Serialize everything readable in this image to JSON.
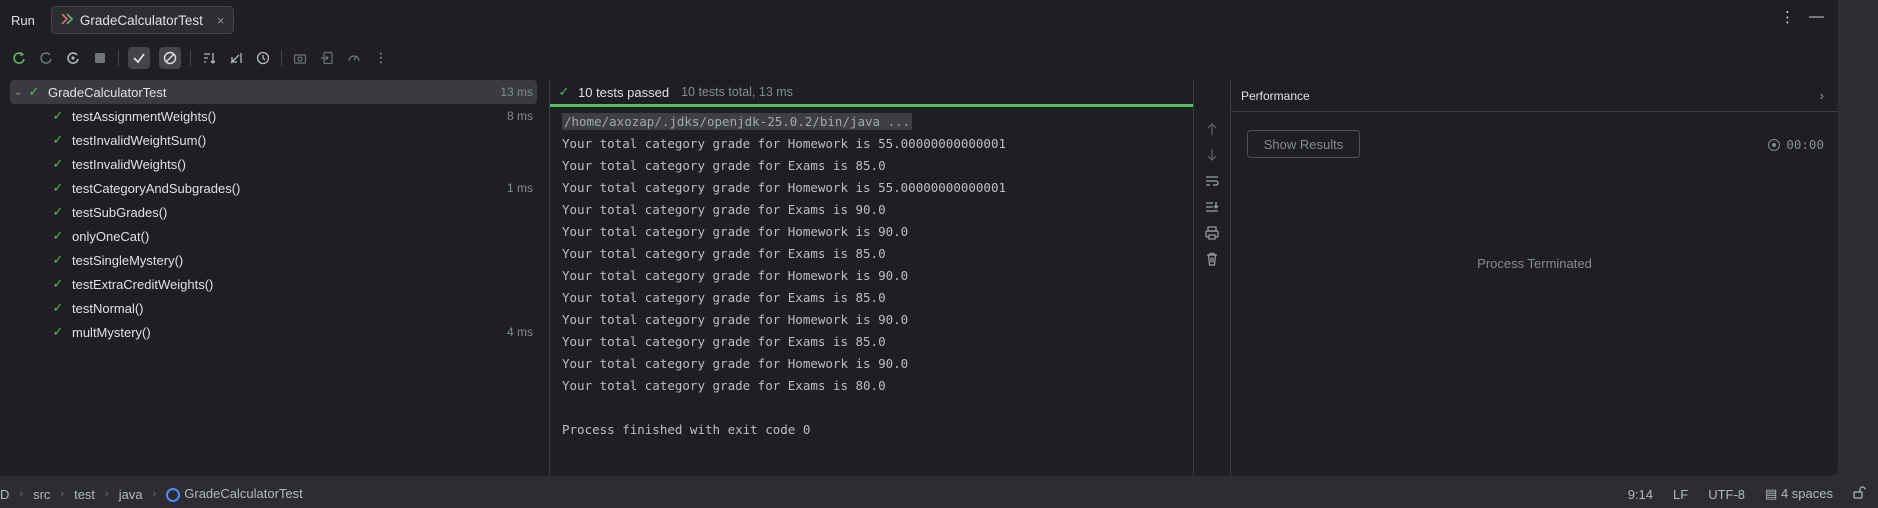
{
  "titlebar": {
    "run_label": "Run",
    "tab_label": "GradeCalculatorTest",
    "tab_close": "×",
    "more_icon": "⋮",
    "minimize_icon": "—"
  },
  "toolbar": {
    "icons": [
      "rerun-icon",
      "rerun-failed-icon",
      "toggle-autotest-icon",
      "stop-icon",
      "show-passed-icon",
      "show-ignored-icon",
      "sort-icon",
      "collapse-icon",
      "history-icon",
      "screenshot-icon",
      "import-icon",
      "coverage-icon",
      "more-icon"
    ]
  },
  "tree": {
    "root": {
      "name": "GradeCalculatorTest",
      "time": "13 ms"
    },
    "children": [
      {
        "name": "testAssignmentWeights()",
        "time": "8 ms"
      },
      {
        "name": "testInvalidWeightSum()",
        "time": ""
      },
      {
        "name": "testInvalidWeights()",
        "time": ""
      },
      {
        "name": "testCategoryAndSubgrades()",
        "time": "1 ms"
      },
      {
        "name": "testSubGrades()",
        "time": ""
      },
      {
        "name": "onlyOneCat()",
        "time": ""
      },
      {
        "name": "testSingleMystery()",
        "time": ""
      },
      {
        "name": "testExtraCreditWeights()",
        "time": ""
      },
      {
        "name": "testNormal()",
        "time": ""
      },
      {
        "name": "multMystery()",
        "time": "4 ms"
      }
    ]
  },
  "status": {
    "passed": "10 tests passed",
    "total": "10 tests total, 13 ms",
    "progress_fraction": 1.0
  },
  "console": {
    "command": "/home/axozap/.jdks/openjdk-25.0.2/bin/java ...",
    "lines": [
      "Your total category grade for Homework is 55.00000000000001",
      "Your total category grade for Exams is 85.0",
      "Your total category grade for Homework is 55.00000000000001",
      "Your total category grade for Exams is 90.0",
      "Your total category grade for Homework is 90.0",
      "Your total category grade for Exams is 85.0",
      "Your total category grade for Homework is 90.0",
      "Your total category grade for Exams is 85.0",
      "Your total category grade for Homework is 90.0",
      "Your total category grade for Exams is 85.0",
      "Your total category grade for Homework is 90.0",
      "Your total category grade for Exams is 80.0",
      "",
      "Process finished with exit code 0"
    ]
  },
  "performance": {
    "title": "Performance",
    "show_results": "Show Results",
    "timer": "00:00",
    "terminated": "Process Terminated"
  },
  "bottom": {
    "breadcrumbs": [
      "D",
      "src",
      "test",
      "java",
      "GradeCalculatorTest"
    ],
    "position": "9:14",
    "line_sep": "LF",
    "encoding": "UTF-8",
    "indent": "4 spaces"
  },
  "colors": {
    "pass_green": "#5fb865",
    "background": "#1e1f22",
    "accent_blue": "#548af7"
  }
}
